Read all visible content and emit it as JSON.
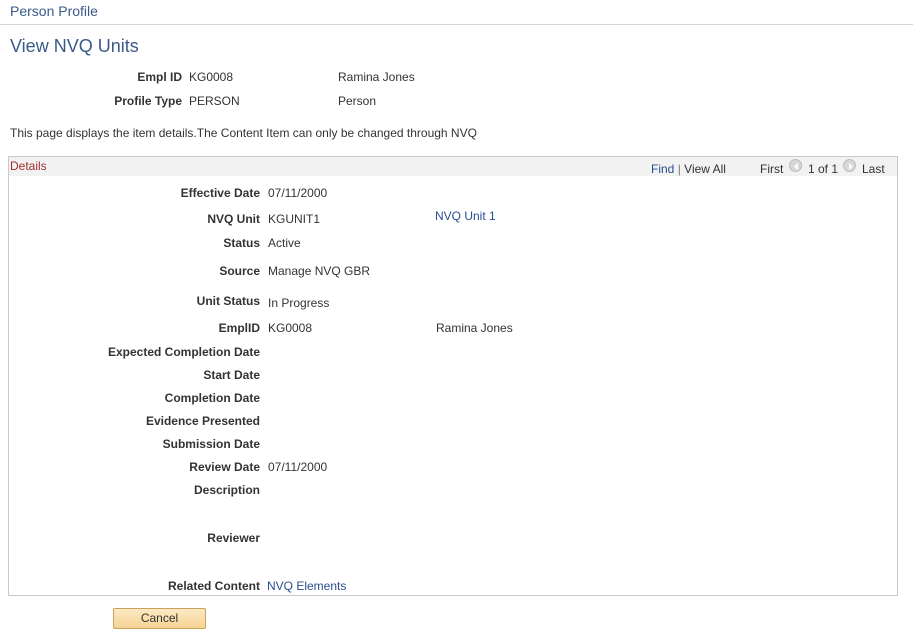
{
  "breadcrumb": "Person Profile",
  "page_title": "View NVQ Units",
  "header": {
    "emplid_label": "Empl ID",
    "emplid_value": "KG0008",
    "name": "Ramina Jones",
    "profile_type_label": "Profile Type",
    "profile_type_value": "PERSON",
    "profile_type_desc": "Person"
  },
  "info_text": "This page displays the item details.The Content Item can only be changed through NVQ",
  "grid": {
    "title": "Details",
    "find": "Find",
    "separator": "|",
    "view_all": "View All",
    "first": "First",
    "count": "1 of 1",
    "last": "Last"
  },
  "details": {
    "effective_date_label": "Effective Date",
    "effective_date": "07/11/2000",
    "nvq_unit_label": "NVQ Unit",
    "nvq_unit": "KGUNIT1",
    "nvq_unit_desc": "NVQ Unit 1",
    "status_label": "Status",
    "status": "Active",
    "source_label": "Source",
    "source": "Manage NVQ GBR",
    "unit_status_label": "Unit Status",
    "unit_status": "In Progress",
    "emplid_label": "EmplID",
    "emplid": "KG0008",
    "emplid_name": "Ramina Jones",
    "expected_completion_label": "Expected Completion Date",
    "start_date_label": "Start Date",
    "completion_date_label": "Completion Date",
    "evidence_label": "Evidence Presented",
    "submission_date_label": "Submission Date",
    "review_date_label": "Review Date",
    "review_date": "07/11/2000",
    "description_label": "Description",
    "reviewer_label": "Reviewer",
    "related_content_label": "Related Content",
    "related_content_link": "NVQ Elements"
  },
  "buttons": {
    "cancel": "Cancel"
  },
  "icons": {
    "prev": "left-arrow-circle-icon",
    "next": "right-arrow-circle-icon"
  }
}
